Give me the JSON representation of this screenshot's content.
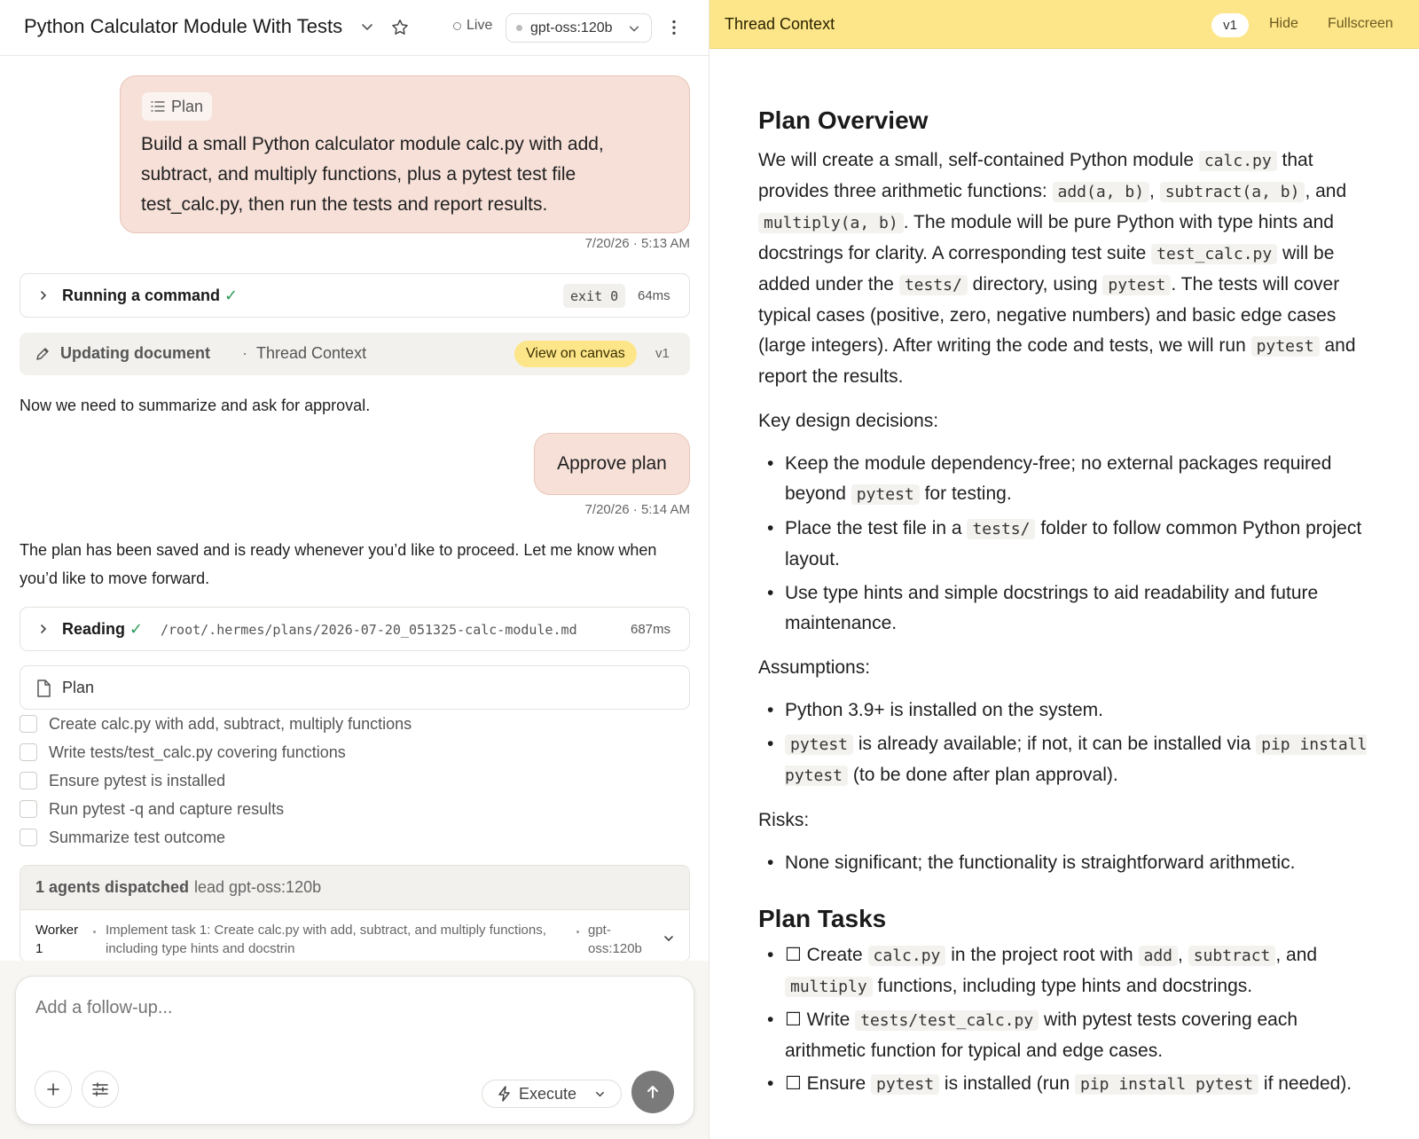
{
  "header": {
    "title": "Python Calculator Module With Tests",
    "live_label": "Live",
    "model": "gpt-oss:120b"
  },
  "messages": {
    "plan_tag": "Plan",
    "plan_text": "Build a small Python calculator module calc.py with add, subtract, and multiply functions, plus a pytest test file test_calc.py, then run the tests and report results.",
    "plan_time": "7/20/26 · 5:13 AM",
    "cmd_label": "Running a command",
    "check": "✓",
    "cmd_exit": "exit 0",
    "cmd_ms": "64ms",
    "upd_label": "Updating document",
    "upd_sep": "·",
    "upd_ctx": "Thread Context",
    "upd_view": "View on canvas",
    "upd_ver": "v1",
    "assistant_1": "Now we need to summarize and ask for approval.",
    "approve_text": "Approve plan",
    "approve_time": "7/20/26 · 5:14 AM",
    "assistant_2": "The plan has been saved and is ready whenever you’d like to proceed. Let me know when you’d like to move forward.",
    "read_label": "Reading",
    "read_path": "/root/.hermes/plans/2026-07-20_051325-calc-module.md",
    "read_ms": "687ms",
    "plan_card_label": "Plan"
  },
  "tasks": [
    "Create calc.py with add, subtract, multiply functions",
    "Write tests/test_calc.py covering functions",
    "Ensure pytest is installed",
    "Run pytest -q and capture results",
    "Summarize test outcome"
  ],
  "agents": {
    "title": "1 agents dispatched",
    "sep": "·",
    "lead": "lead gpt-oss:120b",
    "worker_name": "Worker 1",
    "worker_task": "Implement task 1: Create calc.py with add, subtract, and multiply functions, including type hints and docstrin",
    "worker_model": "gpt-oss:120b"
  },
  "composer": {
    "placeholder": "Add a follow-up...",
    "mode": "Execute"
  },
  "context": {
    "title": "Thread Context",
    "version": "v1",
    "hide": "Hide",
    "fullscreen": "Fullscreen",
    "h_overview": "Plan Overview",
    "ov": {
      "t1": "We will create a small, self-contained Python module ",
      "c1": "calc.py",
      "t2": " that provides three arithmetic functions: ",
      "c2": "add(a, b)",
      "t3": ", ",
      "c3": "subtract(a, b)",
      "t4": ", and ",
      "c4": "multiply(a, b)",
      "t5": ". The module will be pure Python with type hints and docstrings for clarity. A corresponding test suite ",
      "c5": "test_calc.py",
      "t6": " will be added under the ",
      "c6": "tests/",
      "t7": " directory, using ",
      "c7": "pytest",
      "t8": ". The tests will cover typical cases (positive, zero, negative numbers) and basic edge cases (large integers). After writing the code and tests, we will run ",
      "c8": "pytest",
      "t9": " and report the results."
    },
    "key_label": "Key design decisions:",
    "key": {
      "k1a": "Keep the module dependency-free; no external packages required beyond ",
      "k1c": "pytest",
      "k1b": " for testing.",
      "k2a": "Place the test file in a ",
      "k2c": "tests/",
      "k2b": " folder to follow common Python project layout.",
      "k3": "Use type hints and simple docstrings to aid readability and future maintenance."
    },
    "assume_label": "Assumptions:",
    "assume": {
      "a1": "Python 3.9+ is installed on the system.",
      "a2c": "pytest",
      "a2a": " is already available; if not, it can be installed via ",
      "a2c2": "pip install pytest",
      "a2b": " (to be done after plan approval)."
    },
    "risks_label": "Risks:",
    "risk1": "None significant; the functionality is straightforward arithmetic.",
    "h_tasks": "Plan Tasks",
    "pt": {
      "p1a": "☐ Create ",
      "p1c1": "calc.py",
      "p1b": " in the project root with ",
      "p1c2": "add",
      "p1d": ", ",
      "p1c3": "subtract",
      "p1e": ", and ",
      "p1c4": "multiply",
      "p1f": " functions, including type hints and docstrings.",
      "p2a": "☐ Write ",
      "p2c": "tests/test_calc.py",
      "p2b": " with pytest tests covering each arithmetic function for typical and edge cases.",
      "p3a": "☐ Ensure ",
      "p3c1": "pytest",
      "p3b": " is installed (run ",
      "p3c2": "pip install pytest",
      "p3d": " if needed)."
    }
  }
}
